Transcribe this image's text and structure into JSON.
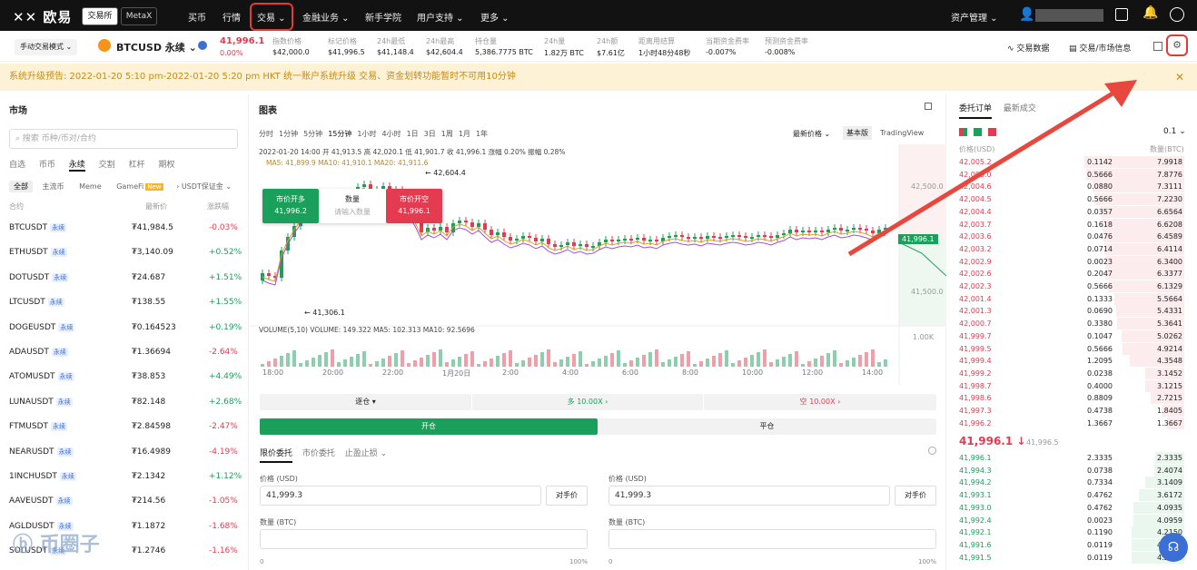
{
  "header": {
    "logo": "欧易",
    "tab_exchange": "交易所",
    "tab_metax": "MetaX",
    "nav": [
      "买币",
      "行情",
      "交易",
      "金融业务",
      "新手学院",
      "用户支持",
      "更多"
    ],
    "asset": "资产管理"
  },
  "ticker": {
    "mode": "手动交易模式",
    "pair": "BTCUSD 永续",
    "price": "41,996.1",
    "change": "0.00%",
    "stats": [
      {
        "label": "指数价格",
        "value": "$42,000.0"
      },
      {
        "label": "标记价格",
        "value": "$41,996.5"
      },
      {
        "label": "24h最低",
        "value": "$41,148.4"
      },
      {
        "label": "24h最高",
        "value": "$42,604.4"
      },
      {
        "label": "持仓量",
        "value": "5,386.7775 BTC"
      },
      {
        "label": "24h量",
        "value": "1.82万 BTC"
      },
      {
        "label": "24h额",
        "value": "$7.61亿"
      },
      {
        "label": "距离用结算",
        "value": "1小时48分48秒"
      },
      {
        "label": "当期资金费率",
        "value": "-0.007%"
      },
      {
        "label": "预测资金费率",
        "value": "-0.008%"
      }
    ],
    "trade_data": "交易数据",
    "trade_info": "交易/市场信息"
  },
  "banner": "系统升级预告: 2022-01-20 5:10 pm-2022-01-20 5:20 pm HKT 统一账户系统升级 交易、资金划转功能暂时不可用10分钟",
  "market": {
    "title": "市场",
    "search_placeholder": "搜索 币种/币对/合约",
    "tabs": [
      "自选",
      "币币",
      "永续",
      "交割",
      "杠杆",
      "期权"
    ],
    "filters": [
      "全部",
      "主流币",
      "Meme",
      "GameFi",
      "USDT保证金"
    ],
    "new_badge": "New",
    "cols": [
      "合约",
      "最新价",
      "涨跌幅"
    ],
    "perp_tag": "永续",
    "rows": [
      {
        "name": "BTCUSDT",
        "price": "₮41,984.5",
        "chg": "-0.03%",
        "up": false
      },
      {
        "name": "ETHUSDT",
        "price": "₮3,140.09",
        "chg": "+0.52%",
        "up": true
      },
      {
        "name": "DOTUSDT",
        "price": "₮24.687",
        "chg": "+1.51%",
        "up": true
      },
      {
        "name": "LTCUSDT",
        "price": "₮138.55",
        "chg": "+1.55%",
        "up": true
      },
      {
        "name": "DOGEUSDT",
        "price": "₮0.164523",
        "chg": "+0.19%",
        "up": true
      },
      {
        "name": "ADAUSDT",
        "price": "₮1.36694",
        "chg": "-2.64%",
        "up": false
      },
      {
        "name": "ATOMUSDT",
        "price": "₮38.853",
        "chg": "+4.49%",
        "up": true
      },
      {
        "name": "LUNAUSDT",
        "price": "₮82.148",
        "chg": "+2.68%",
        "up": true
      },
      {
        "name": "FTMUSDT",
        "price": "₮2.84598",
        "chg": "-2.47%",
        "up": false
      },
      {
        "name": "NEARUSDT",
        "price": "₮16.4989",
        "chg": "-4.19%",
        "up": false
      },
      {
        "name": "1INCHUSDT",
        "price": "₮2.1342",
        "chg": "+1.12%",
        "up": true
      },
      {
        "name": "AAVEUSDT",
        "price": "₮214.56",
        "chg": "-1.05%",
        "up": false
      },
      {
        "name": "AGLDUSDT",
        "price": "₮1.1872",
        "chg": "-1.68%",
        "up": false
      },
      {
        "name": "SOLUSDT",
        "price": "₮1.2746",
        "chg": "-1.16%",
        "up": false
      }
    ]
  },
  "chart": {
    "title": "图表",
    "intervals": [
      "分时",
      "1分钟",
      "5分钟",
      "15分钟",
      "1小时",
      "4小时",
      "1日",
      "3日",
      "1周",
      "1月",
      "1年"
    ],
    "price_type": "最新价格",
    "basic": "基本版",
    "tv": "TradingView",
    "ohlc": "2022-01-20 14:00  开 41,913.5  高 42,020.1  低 41,901.7  收 41,996.1  涨幅 0.20%  振幅 0.28%",
    "ma": "MA5: 41,899.9  MA10: 41,910.1  MA20: 41,911.6",
    "hi_label": "42,604.4",
    "lo_label": "41,306.1",
    "axis": [
      "42,500.0",
      "41,500.0",
      "1.00K"
    ],
    "last": "41,996.1",
    "vol": "VOLUME(5,10)  VOLUME: 149.322  MA5: 102.313  MA10: 92.5696",
    "times": [
      "18:00",
      "20:00",
      "22:00",
      "1月20日",
      "2:00",
      "4:00",
      "6:00",
      "8:00",
      "10:00",
      "12:00",
      "14:00"
    ],
    "quick_long": "市价开多",
    "quick_long_px": "41,996.2",
    "quick_qty": "数量",
    "quick_qty_ph": "请输入数量",
    "quick_short": "市价开空",
    "quick_short_px": "41,996.1"
  },
  "order": {
    "margin": "逐仓 ▾",
    "long_lev": "多 10.00X ›",
    "short_lev": "空 10.00X ›",
    "open": "开仓",
    "close": "平仓",
    "types": [
      "限价委托",
      "市价委托",
      "止盈止损 ⌄"
    ],
    "price_label": "价格 (USD)",
    "price_val": "41,999.3",
    "opp": "对手价",
    "qty_label": "数量 (BTC)",
    "pct0": "0",
    "pct100": "100%"
  },
  "book": {
    "tabs": [
      "委托订单",
      "最新成交"
    ],
    "step": "0.1",
    "col_price": "价格(USD)",
    "col_total": "数量(BTC)",
    "asks": [
      [
        "42,005.2",
        "0.1142",
        "7.9918"
      ],
      [
        "42,005.0",
        "0.5666",
        "7.8776"
      ],
      [
        "42,004.6",
        "0.0880",
        "7.3111"
      ],
      [
        "42,004.5",
        "0.5666",
        "7.2230"
      ],
      [
        "42,004.4",
        "0.0357",
        "6.6564"
      ],
      [
        "42,003.7",
        "0.1618",
        "6.6208"
      ],
      [
        "42,003.6",
        "0.0476",
        "6.4589"
      ],
      [
        "42,003.2",
        "0.0714",
        "6.4114"
      ],
      [
        "42,002.9",
        "0.0023",
        "6.3400"
      ],
      [
        "42,002.6",
        "0.2047",
        "6.3377"
      ],
      [
        "42,002.3",
        "0.5666",
        "6.1329"
      ],
      [
        "42,001.4",
        "0.1333",
        "5.5664"
      ],
      [
        "42,001.3",
        "0.0690",
        "5.4331"
      ],
      [
        "42,000.7",
        "0.3380",
        "5.3641"
      ],
      [
        "41,999.7",
        "0.1047",
        "5.0262"
      ],
      [
        "41,999.5",
        "0.5666",
        "4.9214"
      ],
      [
        "41,999.4",
        "1.2095",
        "4.3548"
      ],
      [
        "41,999.2",
        "0.0238",
        "3.1452"
      ],
      [
        "41,998.7",
        "0.4000",
        "3.1215"
      ],
      [
        "41,998.6",
        "0.8809",
        "2.7215"
      ],
      [
        "41,997.3",
        "0.4738",
        "1.8405"
      ],
      [
        "41,996.2",
        "1.3667",
        "1.3667"
      ]
    ],
    "mid": "41,996.1 ↓",
    "mid_mark": "41,996.5",
    "bids": [
      [
        "41,996.1",
        "2.3335",
        "2.3335"
      ],
      [
        "41,994.3",
        "0.0738",
        "2.4074"
      ],
      [
        "41,994.2",
        "0.7334",
        "3.1409"
      ],
      [
        "41,993.1",
        "0.4762",
        "3.6172"
      ],
      [
        "41,993.0",
        "0.4762",
        "4.0935"
      ],
      [
        "41,992.4",
        "0.0023",
        "4.0959"
      ],
      [
        "41,992.1",
        "0.1190",
        "4.2150"
      ],
      [
        "41,991.6",
        "0.0119",
        "4.2270"
      ],
      [
        "41,991.5",
        "0.0119",
        "4.2270"
      ]
    ]
  },
  "watermark": "币圈子"
}
